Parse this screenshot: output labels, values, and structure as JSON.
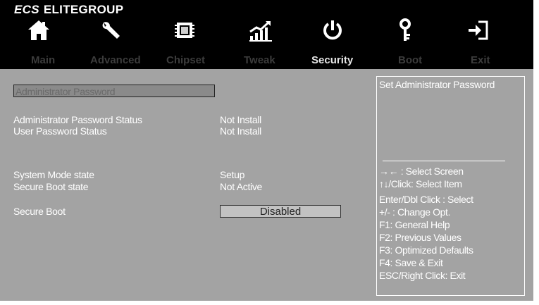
{
  "brand": {
    "logo": "ECS",
    "name": "ELITEGROUP"
  },
  "icons": [
    {
      "name": "home-icon"
    },
    {
      "name": "wrench-icon"
    },
    {
      "name": "chip-icon"
    },
    {
      "name": "performance-chart-icon"
    },
    {
      "name": "power-icon"
    },
    {
      "name": "key-icon"
    },
    {
      "name": "exit-icon"
    }
  ],
  "tabs": [
    {
      "label": "Main",
      "active": false
    },
    {
      "label": "Advanced",
      "active": false
    },
    {
      "label": "Chipset",
      "active": false
    },
    {
      "label": "Tweak",
      "active": false
    },
    {
      "label": "Security",
      "active": true
    },
    {
      "label": "Boot",
      "active": false
    },
    {
      "label": "Exit",
      "active": false
    }
  ],
  "security": {
    "admin_password_label": "Administrator  Password",
    "admin_status_label": "Administrator Password Status",
    "admin_status_value": "Not Install",
    "user_status_label": "User Password Status",
    "user_status_value": "Not Install",
    "system_mode_label": "System Mode state",
    "system_mode_value": "Setup",
    "secure_boot_state_label": "Secure Boot state",
    "secure_boot_state_value": "Not Active",
    "secure_boot_label": "Secure Boot",
    "secure_boot_value": "Disabled"
  },
  "help": {
    "title": "Set Administrator Password",
    "lines": [
      "→←  : Select Screen",
      "↑↓/Click: Select Item",
      "Enter/Dbl Click : Select",
      "+/- : Change Opt.",
      "F1: General Help",
      "F2: Previous Values",
      "F3: Optimized Defaults",
      "F4: Save & Exit",
      "ESC/Right Click: Exit"
    ]
  },
  "colors": {
    "background": "#a3a3a3",
    "topbar": "#000000",
    "text": "#ffffff",
    "active_tab": "#e6e6e6",
    "inactive_tab": "#3c3c3c"
  }
}
